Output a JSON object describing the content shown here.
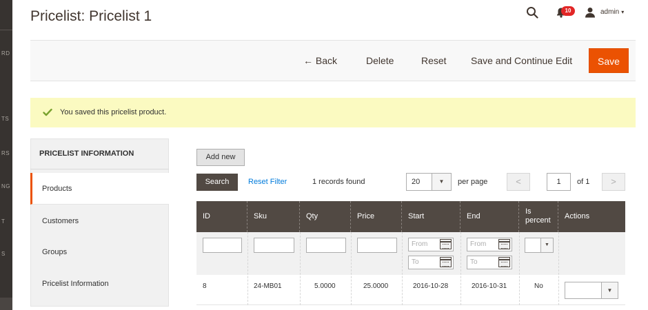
{
  "sidebar": {
    "fragments": [
      "RD",
      "TS",
      "RS",
      "NG",
      "T",
      "S"
    ]
  },
  "header": {
    "title": "Pricelist: Pricelist 1",
    "notifications_count": "10",
    "user": "admin",
    "user_caret": "▾"
  },
  "actions": {
    "back": "← Back",
    "delete": "Delete",
    "reset": "Reset",
    "save_continue": "Save and Continue Edit",
    "save": "Save"
  },
  "message": {
    "text": "You saved this pricelist product."
  },
  "tabs": {
    "title": "PRICELIST INFORMATION",
    "items": [
      {
        "label": "Products",
        "active": true
      },
      {
        "label": "Customers",
        "active": false
      },
      {
        "label": "Groups",
        "active": false
      },
      {
        "label": "Pricelist Information",
        "active": false
      }
    ]
  },
  "grid": {
    "add_new": "Add new",
    "search": "Search",
    "reset_filter": "Reset Filter",
    "records_found": "1 records found",
    "per_page_value": "20",
    "per_page_label": "per page",
    "page": "1",
    "of_pages": "of 1",
    "columns": [
      "ID",
      "Sku",
      "Qty",
      "Price",
      "Start",
      "End",
      "Is percent",
      "Actions"
    ],
    "filter_placeholders": {
      "from": "From",
      "to": "To"
    },
    "rows": [
      {
        "id": "8",
        "sku": "24-MB01",
        "qty": "5.0000",
        "price": "25.0000",
        "start": "2016-10-28",
        "end": "2016-10-31",
        "is_percent": "No"
      }
    ]
  },
  "colors": {
    "accent": "#eb5202",
    "header_dark": "#514943",
    "link": "#007bdb",
    "success_bg": "#fbfac1",
    "badge": "#e22626"
  },
  "icons": [
    "search-icon",
    "bell-icon",
    "user-icon",
    "checkmark-icon",
    "calendar-icon",
    "chevron-down-icon",
    "chevron-left-icon",
    "chevron-right-icon"
  ]
}
